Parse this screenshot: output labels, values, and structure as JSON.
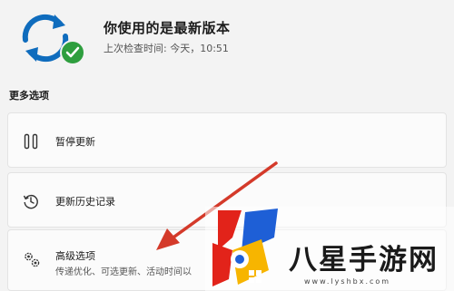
{
  "status": {
    "title": "你使用的是最新版本",
    "last_checked": "上次检查时间: 今天，10:51",
    "icon": "sync-check-icon"
  },
  "section_heading": "更多选项",
  "options": [
    {
      "label": "暂停更新",
      "icon": "pause-icon"
    },
    {
      "label": "更新历史记录",
      "icon": "history-icon"
    },
    {
      "label": "高级选项",
      "description": "传递优化、可选更新、活动时间以",
      "icon": "gears-icon"
    }
  ],
  "watermark": {
    "text": "八星手游网",
    "url": "www.lyshbx.com",
    "colors": {
      "red": "#e2231a",
      "blue": "#1e5fd6",
      "yellow": "#f7b500"
    }
  },
  "colors": {
    "accent": "#0f6cbd",
    "success": "#2e9e3e",
    "arrow": "#d43a2a"
  }
}
